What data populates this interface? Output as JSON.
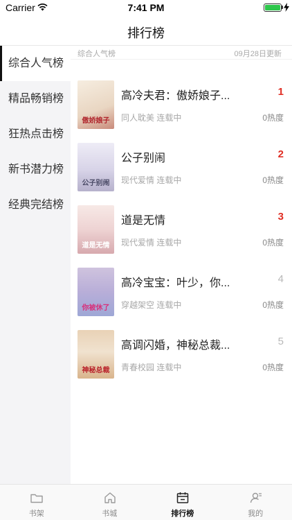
{
  "status": {
    "carrier": "Carrier",
    "time": "7:41 PM"
  },
  "nav": {
    "title": "排行榜"
  },
  "sidebar": {
    "items": [
      {
        "label": "综合人气榜",
        "active": true
      },
      {
        "label": "精品畅销榜",
        "active": false
      },
      {
        "label": "狂热点击榜",
        "active": false
      },
      {
        "label": "新书潜力榜",
        "active": false
      },
      {
        "label": "经典完结榜",
        "active": false
      }
    ]
  },
  "content": {
    "category": "综合人气榜",
    "updated": "09月28日更新",
    "books": [
      {
        "rank": "1",
        "title": "高冷夫君：傲娇娘子...",
        "meta": "同人耽美 连载中",
        "heat": "0热度",
        "cover_text": "傲娇娘子",
        "cover_bg": "#efe4d4",
        "cover_color": "#b0262d"
      },
      {
        "rank": "2",
        "title": "公子别闹",
        "meta": "现代爱情 连载中",
        "heat": "0热度",
        "cover_text": "公子别闹",
        "cover_bg": "#e8e4f0",
        "cover_color": "#4a4a66"
      },
      {
        "rank": "3",
        "title": "道是无情",
        "meta": "现代爱情 连载中",
        "heat": "0热度",
        "cover_text": "道是无情",
        "cover_bg": "#f3dfe1",
        "cover_color": "#ffffff"
      },
      {
        "rank": "4",
        "title": "高冷宝宝：叶少，你...",
        "meta": "穿越架空 连载中",
        "heat": "0热度",
        "cover_text": "你被休了",
        "cover_bg": "#d9d3ea",
        "cover_color": "#d8307a"
      },
      {
        "rank": "5",
        "title": "高调闪婚，神秘总裁...",
        "meta": "青春校园 连载中",
        "heat": "0热度",
        "cover_text": "神秘总裁",
        "cover_bg": "#efdcc4",
        "cover_color": "#b81d27"
      }
    ]
  },
  "tabs": [
    {
      "label": "书架",
      "icon": "folder-icon",
      "active": false
    },
    {
      "label": "书城",
      "icon": "home-icon",
      "active": false
    },
    {
      "label": "排行榜",
      "icon": "calendar-icon",
      "active": true
    },
    {
      "label": "我的",
      "icon": "user-icon",
      "active": false
    }
  ],
  "colors": {
    "accent": "#e02e24",
    "sidebar_bg": "#f4f4f6",
    "battery": "#2ec74c"
  }
}
